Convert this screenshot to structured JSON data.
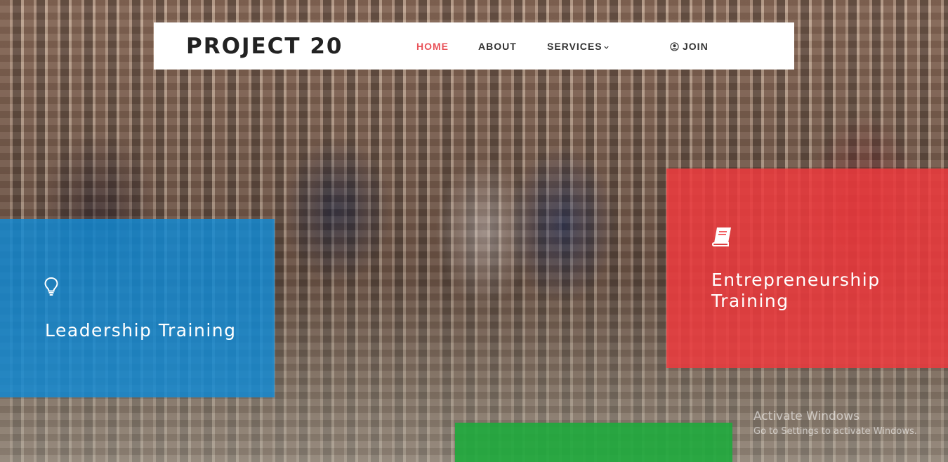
{
  "brand": {
    "name": "PROJECT 20"
  },
  "nav": {
    "home": "HOME",
    "about": "ABOUT",
    "services": "SERVICES",
    "join": "JOIN"
  },
  "features": {
    "leadership": {
      "title": "Leadership Training",
      "icon": "lightbulb-icon",
      "color": "#108ad6"
    },
    "entrepreneurship": {
      "title": "Entrepreneurship Training",
      "icon": "book-icon",
      "color": "#ee3a3e"
    },
    "third": {
      "color": "#1eaa3c"
    }
  },
  "colors": {
    "active_nav": "#e9535a",
    "nav_text": "#333333"
  },
  "watermark": {
    "title": "Activate Windows",
    "subtitle": "Go to Settings to activate Windows."
  }
}
